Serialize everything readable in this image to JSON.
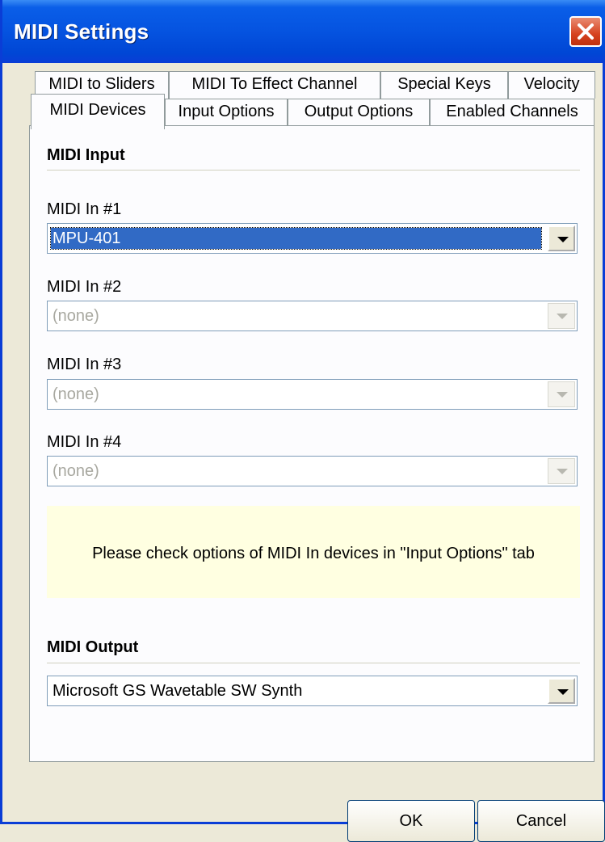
{
  "window": {
    "title": "MIDI Settings"
  },
  "tabs_row1": [
    "MIDI to Sliders",
    "MIDI To Effect Channel",
    "Special Keys",
    "Velocity"
  ],
  "tabs_row2": [
    "MIDI Devices",
    "Input Options",
    "Output Options",
    "Enabled Channels"
  ],
  "active_tab": "MIDI Devices",
  "midi_input": {
    "title": "MIDI Input",
    "devices": [
      {
        "label": "MIDI In #1",
        "value": "MPU-401",
        "enabled": true,
        "selected": true
      },
      {
        "label": "MIDI In #2",
        "value": "(none)",
        "enabled": false
      },
      {
        "label": "MIDI In #3",
        "value": "(none)",
        "enabled": false
      },
      {
        "label": "MIDI In #4",
        "value": "(none)",
        "enabled": false
      }
    ],
    "note": "Please check options of MIDI In devices in \"Input Options\" tab"
  },
  "midi_output": {
    "title": "MIDI Output",
    "value": "Microsoft GS Wavetable SW Synth"
  },
  "buttons": {
    "ok": "OK",
    "cancel": "Cancel"
  },
  "colors": {
    "titlebar": "#0553e0",
    "selection": "#316ac5",
    "note_bg": "#ffffe1",
    "close": "#d6421f"
  }
}
